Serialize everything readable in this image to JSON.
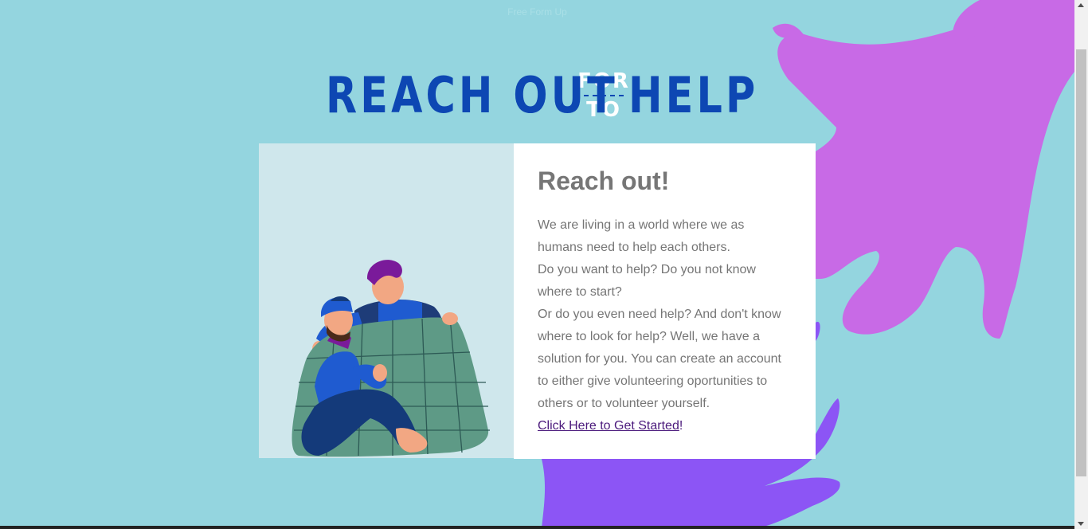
{
  "top_notice": "Free Form Up",
  "banner": {
    "word1": "REACH OUT",
    "option_top": "FOR",
    "option_bottom": "TO",
    "word2": "HELP"
  },
  "card": {
    "heading": "Reach out!",
    "paragraphs": [
      "We are living in a world where we as humans need to help each others.",
      "Do you want to help? Do you not know where to start?",
      "Or do you even need help? And don't know where to look for help? Well, we have a solution for you. You can create an account to either give volunteering oportunities to others or to volunteer yourself."
    ],
    "link_text": "Click Here to Get Started",
    "link_suffix": "!"
  },
  "colors": {
    "background": "#94d5df",
    "banner_blue": "#0d47b3",
    "hand_pink": "#c86ae6",
    "hand_purple": "#8c55f5",
    "link": "#4b1a7c"
  },
  "icons": [
    "scroll-up-arrow-icon",
    "scroll-down-arrow-icon"
  ]
}
